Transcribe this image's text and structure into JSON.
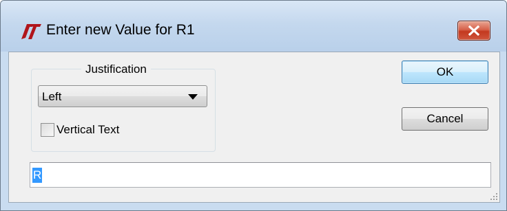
{
  "window": {
    "title": "Enter new Value for R1",
    "logo_icon": "linear-technology-logo-icon",
    "close_icon": "close-icon",
    "colors": {
      "frame": "#c4d8ee",
      "close_button": "#c3391f",
      "client_background": "#f0f0f0",
      "selection": "#3399ff"
    }
  },
  "justification": {
    "legend": "Justification",
    "selected": "Left",
    "dropdown_icon": "dropdown-arrow-icon"
  },
  "vertical_text": {
    "label": "Vertical Text",
    "checked": false
  },
  "buttons": {
    "ok": "OK",
    "cancel": "Cancel"
  },
  "value_field": {
    "value": "R",
    "selected": true
  }
}
